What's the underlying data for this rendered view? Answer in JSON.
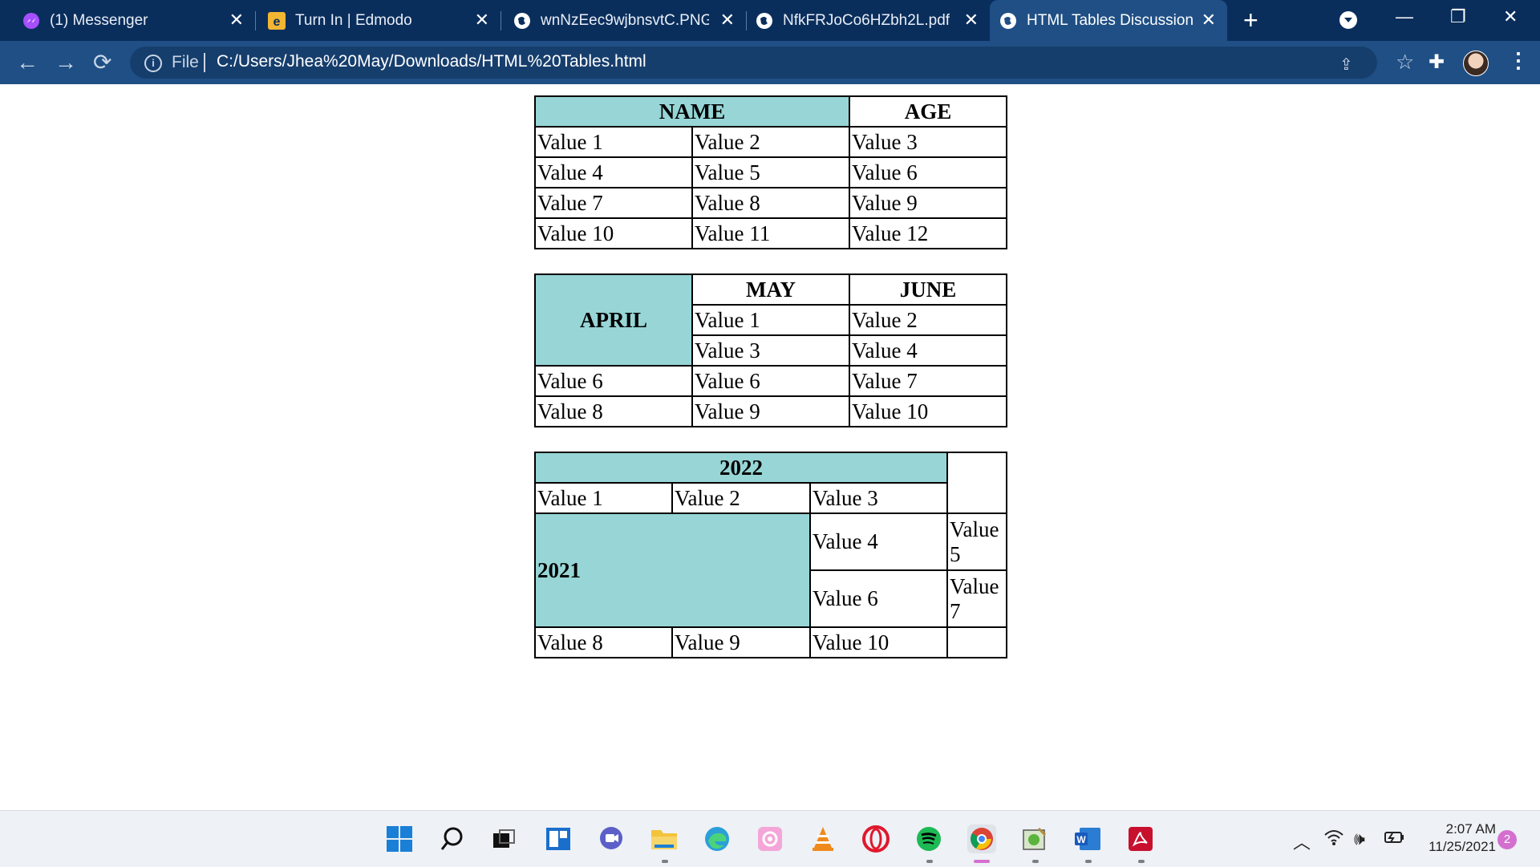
{
  "tabs": [
    {
      "title": "(1) Messenger",
      "icon": "messenger-icon"
    },
    {
      "title": "Turn In | Edmodo",
      "icon": "edmodo-icon"
    },
    {
      "title": "wnNzEec9wjbnsvtC.PNG (",
      "icon": "globe-icon"
    },
    {
      "title": "NfkFRJoCo6HZbh2L.pdf",
      "icon": "globe-icon"
    },
    {
      "title": "HTML Tables Discussion",
      "icon": "globe-icon"
    }
  ],
  "omnibox": {
    "scheme": "File",
    "url": "C:/Users/Jhea%20May/Downloads/HTML%20Tables.html"
  },
  "table1": {
    "headers": [
      "NAME",
      "AGE"
    ],
    "rows": [
      [
        "Value 1",
        "Value 2",
        "Value 3"
      ],
      [
        "Value 4",
        "Value 5",
        "Value 6"
      ],
      [
        "Value 7",
        "Value 8",
        "Value 9"
      ],
      [
        "Value 10",
        "Value 11",
        "Value 12"
      ]
    ]
  },
  "table2": {
    "row_header": "APRIL",
    "headers": [
      "MAY",
      "JUNE"
    ],
    "rows": [
      [
        "Value 1",
        "Value 2"
      ],
      [
        "Value 3",
        "Value 4"
      ],
      [
        "Value 6",
        "Value 6",
        "Value 7"
      ],
      [
        "Value 8",
        "Value 9",
        "Value 10"
      ]
    ]
  },
  "table3": {
    "header": "2022",
    "row_header": "2021",
    "row1": [
      "Value 1",
      "Value 2",
      "Value 3"
    ],
    "mid": [
      "Value 4",
      "Value 5",
      "Value 6",
      "Value 7"
    ],
    "last": [
      "Value 8",
      "Value 9",
      "Value 10"
    ]
  },
  "taskbar": {
    "time": "2:07 AM",
    "date": "11/25/2021",
    "notifications": "2"
  },
  "colors": {
    "tabstrip": "#0a2e5c",
    "toolbar": "#1f4f85",
    "table_highlight": "#97d5d6"
  }
}
